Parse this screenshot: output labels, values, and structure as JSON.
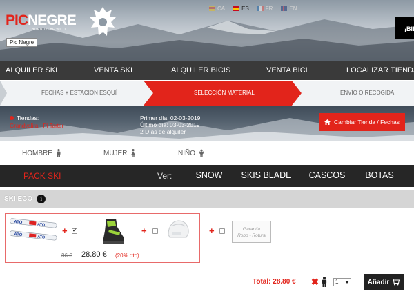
{
  "header": {
    "logo_pic": "PIC",
    "logo_negre": "NEGRE",
    "logo_tagline": "BORN TO BE WILD",
    "tooltip": "Pic Negre",
    "languages": [
      {
        "code": "CA",
        "active": false
      },
      {
        "code": "ES",
        "active": true
      },
      {
        "code": "FR",
        "active": false
      },
      {
        "code": "EN",
        "active": false
      }
    ],
    "corner_button": "¡BIE"
  },
  "nav": {
    "items": [
      "ALQUILER SKI",
      "VENTA SKI",
      "ALQUILER BICIS",
      "VENTA BICI",
      "LOCALIZAR TIENDAS"
    ]
  },
  "steps": {
    "items": [
      {
        "label": "FECHAS + ESTACIÓN ESQUÍ",
        "active": false
      },
      {
        "label": "SELECCIÓN MATERIAL",
        "active": true
      },
      {
        "label": "ENVÍO O RECOGIDA",
        "active": false
      }
    ]
  },
  "booking": {
    "stores_label": "Tiendas:",
    "store_name": "Grandvalira - Pi Tarter",
    "first_day": "Primer día: 02-03-2019",
    "last_day": "Último día: 03-03-2019",
    "days": "2 Días de alquiler",
    "change_button": "Cambiar Tienda / Fechas"
  },
  "gender": {
    "items": [
      "HOMBRE",
      "MUJER",
      "NIÑO"
    ]
  },
  "categories": {
    "pack": "PACK SKI",
    "ver_label": "Ver:",
    "items": [
      "SNOW",
      "SKIS BLADE",
      "CASCOS",
      "BOTAS"
    ]
  },
  "section": {
    "title": "SKI ECO",
    "info_icon": "i"
  },
  "product": {
    "old_price": "36 €",
    "price": "28.80 €",
    "discount": "(20% dto)",
    "garantia_line1": "Garantia",
    "garantia_line2": "Robo - Rotura"
  },
  "cart": {
    "total": "Total: 28.80 €",
    "times": "✖",
    "quantity": "1",
    "add_button": "Añadir"
  },
  "colors": {
    "brand_red": "#e2241b",
    "dark_bar": "#262626",
    "nav_bar": "#3a3a3a"
  }
}
